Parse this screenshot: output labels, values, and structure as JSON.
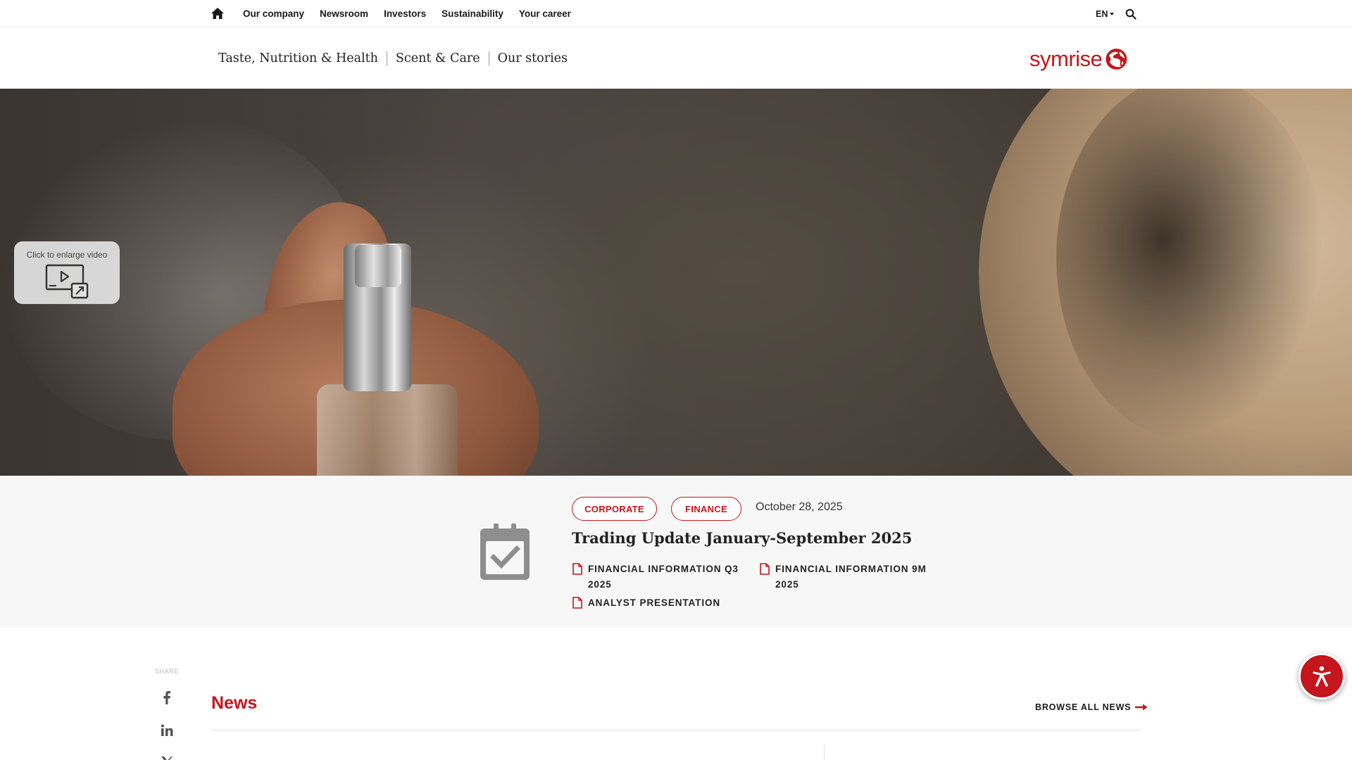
{
  "top_nav": {
    "items": [
      {
        "label": "Our company"
      },
      {
        "label": "Newsroom"
      },
      {
        "label": "Investors"
      },
      {
        "label": "Sustainability"
      },
      {
        "label": "Your career"
      }
    ],
    "language": "EN"
  },
  "main_nav": {
    "items": [
      {
        "label": "Taste, Nutrition & Health"
      },
      {
        "label": "Scent & Care"
      },
      {
        "label": "Our stories"
      }
    ],
    "logo_text": "symrise"
  },
  "hero": {
    "video_button_label": "Click to enlarge video"
  },
  "teaser": {
    "tags": [
      {
        "label": "CORPORATE"
      },
      {
        "label": "FINANCE"
      }
    ],
    "date": "October 28, 2025",
    "title": "Trading Update January-September 2025",
    "documents": [
      {
        "label": "FINANCIAL INFORMATION Q3 2025"
      },
      {
        "label": "FINANCIAL INFORMATION 9M 2025"
      },
      {
        "label": "ANALYST PRESENTATION"
      }
    ]
  },
  "share": {
    "label": "SHARE",
    "networks": [
      "facebook-icon",
      "linkedin-icon",
      "x-icon"
    ]
  },
  "news": {
    "heading": "News",
    "browse_label": "BROWSE ALL NEWS"
  },
  "colors": {
    "brand_red": "#c4161c",
    "band_bg": "#f7f7f7",
    "icon_gray": "#8e8e8e"
  }
}
